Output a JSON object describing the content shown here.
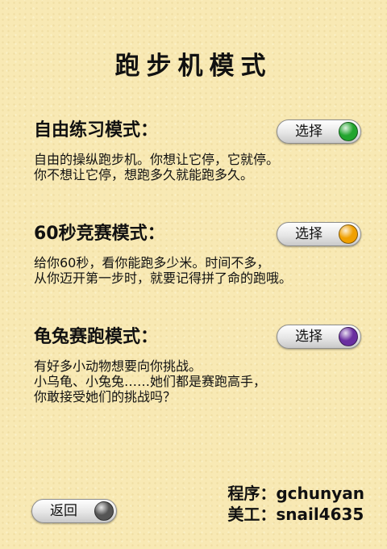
{
  "title": "跑步机模式",
  "modes": [
    {
      "heading": "自由练习模式：",
      "lines": [
        "自由的操纵跑步机。你想让它停，它就停。",
        "你不想让它停，想跑多久就能跑多久。"
      ],
      "button_label": "选择",
      "indicator_color": "#22a52e"
    },
    {
      "heading": "60秒竞赛模式：",
      "lines": [
        "给你60秒，看你能跑多少米。时间不多，",
        "从你迈开第一步时，就要记得拼了命的跑哦。"
      ],
      "button_label": "选择",
      "indicator_color": "#f0a000"
    },
    {
      "heading": "龟兔赛跑模式：",
      "lines": [
        "有好多小动物想要向你挑战。",
        "小乌龟、小兔兔……她们都是赛跑高手，",
        "你敢接受她们的挑战吗？"
      ],
      "button_label": "选择",
      "indicator_color": "#6a2ea0"
    }
  ],
  "back_button": {
    "label": "返回",
    "indicator_color": "#555555"
  },
  "credits": {
    "programmer": "程序：gchunyan",
    "artist": "美工：snail4635"
  }
}
